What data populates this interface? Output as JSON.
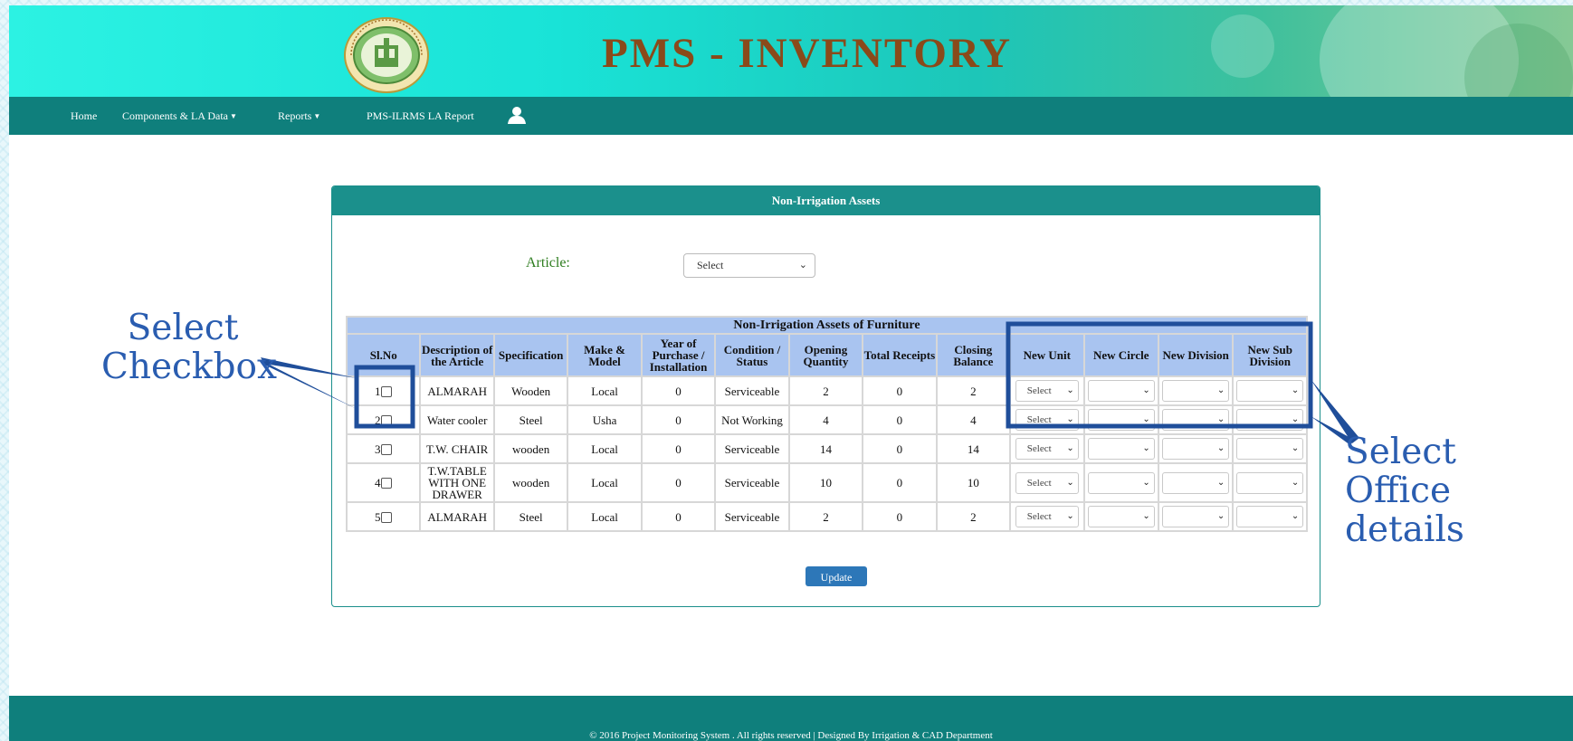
{
  "header": {
    "title": "PMS - INVENTORY",
    "emblem_icon": "telangana-emblem"
  },
  "nav": {
    "items": [
      {
        "label": "Home",
        "dropdown": false
      },
      {
        "label": "Components & LA Data",
        "dropdown": true
      },
      {
        "label": "Reports",
        "dropdown": true
      },
      {
        "label": "PMS-ILRMS LA Report",
        "dropdown": false
      }
    ],
    "user_icon": "user-icon"
  },
  "panel": {
    "title": "Non-Irrigation Assets",
    "article_label": "Article:",
    "article_select_value": "Select",
    "table_caption": "Non-Irrigation Assets of Furniture",
    "columns": [
      "Sl.No",
      "Description of the Article",
      "Specification",
      "Make & Model",
      "Year of Purchase / Installation",
      "Condition / Status",
      "Opening Quantity",
      "Total Receipts",
      "Closing Balance",
      "New Unit",
      "New Circle",
      "New Division",
      "New Sub Division"
    ],
    "rows": [
      {
        "sl": "1",
        "desc": "ALMARAH",
        "spec": "Wooden",
        "make": "Local",
        "year": "0",
        "condition": "Serviceable",
        "opening": "2",
        "receipts": "0",
        "closing": "2",
        "unit": "Select",
        "circle": "",
        "division": "",
        "subdivision": ""
      },
      {
        "sl": "2",
        "desc": "Water cooler",
        "spec": "Steel",
        "make": "Usha",
        "year": "0",
        "condition": "Not Working",
        "opening": "4",
        "receipts": "0",
        "closing": "4",
        "unit": "Select",
        "circle": "",
        "division": "",
        "subdivision": ""
      },
      {
        "sl": "3",
        "desc": "T.W. CHAIR",
        "spec": "wooden",
        "make": "Local",
        "year": "0",
        "condition": "Serviceable",
        "opening": "14",
        "receipts": "0",
        "closing": "14",
        "unit": "Select",
        "circle": "",
        "division": "",
        "subdivision": ""
      },
      {
        "sl": "4",
        "desc": "T.W.TABLE WITH ONE DRAWER",
        "spec": "wooden",
        "make": "Local",
        "year": "0",
        "condition": "Serviceable",
        "opening": "10",
        "receipts": "0",
        "closing": "10",
        "unit": "Select",
        "circle": "",
        "division": "",
        "subdivision": ""
      },
      {
        "sl": "5",
        "desc": "ALMARAH",
        "spec": "Steel",
        "make": "Local",
        "year": "0",
        "condition": "Serviceable",
        "opening": "2",
        "receipts": "0",
        "closing": "2",
        "unit": "Select",
        "circle": "",
        "division": "",
        "subdivision": ""
      }
    ],
    "update_label": "Update"
  },
  "footer": {
    "text": "© 2016 Project Monitoring System . All rights reserved | Designed By Irrigation & CAD Department"
  },
  "annotations": {
    "left_callout": "Select Checkbox",
    "right_callout": "Select Office details",
    "highlight_color": "#1f4e9a"
  }
}
